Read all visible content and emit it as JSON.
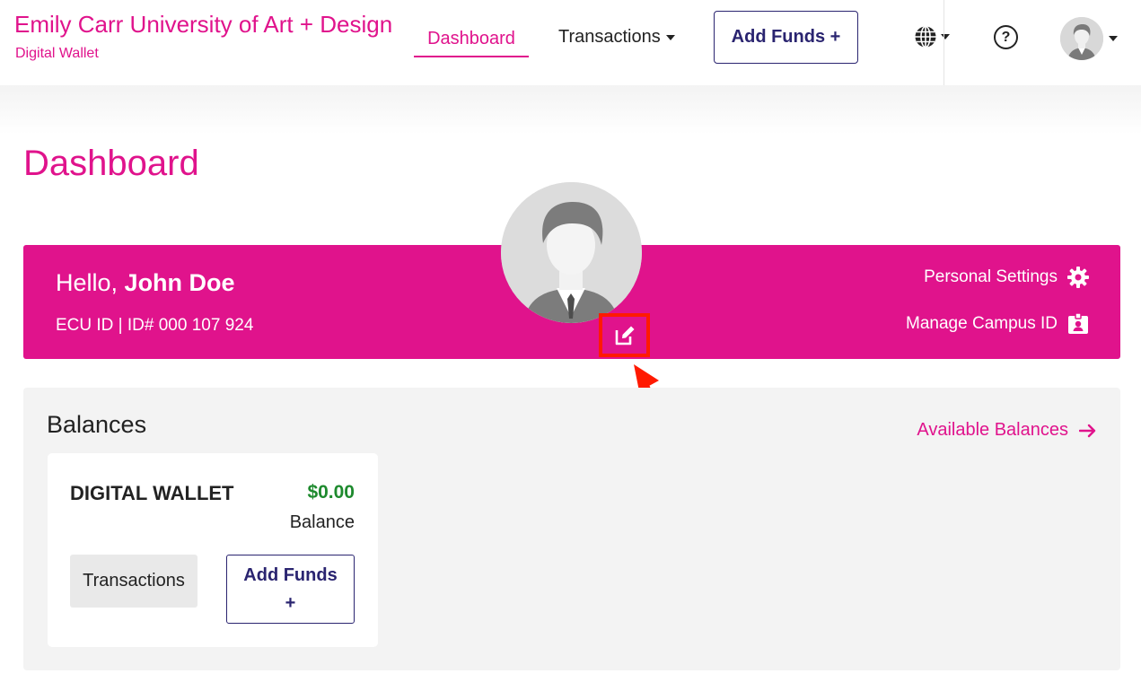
{
  "header": {
    "brand_title": "Emily Carr University of Art + Design",
    "brand_subtitle": "Digital Wallet",
    "nav": {
      "dashboard": "Dashboard",
      "transactions": "Transactions"
    },
    "add_funds": "Add Funds +",
    "help_label": "?",
    "icons": [
      "globe-icon",
      "help-icon",
      "avatar",
      "chevron-down-icon"
    ]
  },
  "page": {
    "title": "Dashboard"
  },
  "banner": {
    "greeting": "Hello,",
    "user_name": "John Doe",
    "id_line": "ECU ID | ID# 000 107 924",
    "personal_settings": "Personal Settings",
    "manage_campus_id": "Manage Campus ID",
    "background_color": "#e0138c"
  },
  "balances": {
    "title": "Balances",
    "available_link": "Available Balances",
    "wallet": {
      "name": "DIGITAL WALLET",
      "amount": "$0.00",
      "amount_label": "Balance",
      "transactions_button": "Transactions",
      "add_funds_line1": "Add Funds",
      "add_funds_line2": "+"
    }
  },
  "colors": {
    "brand": "#e0138c",
    "navy": "#2a2470",
    "positive": "#1e8a2e",
    "annotation": "#ff1a00"
  }
}
